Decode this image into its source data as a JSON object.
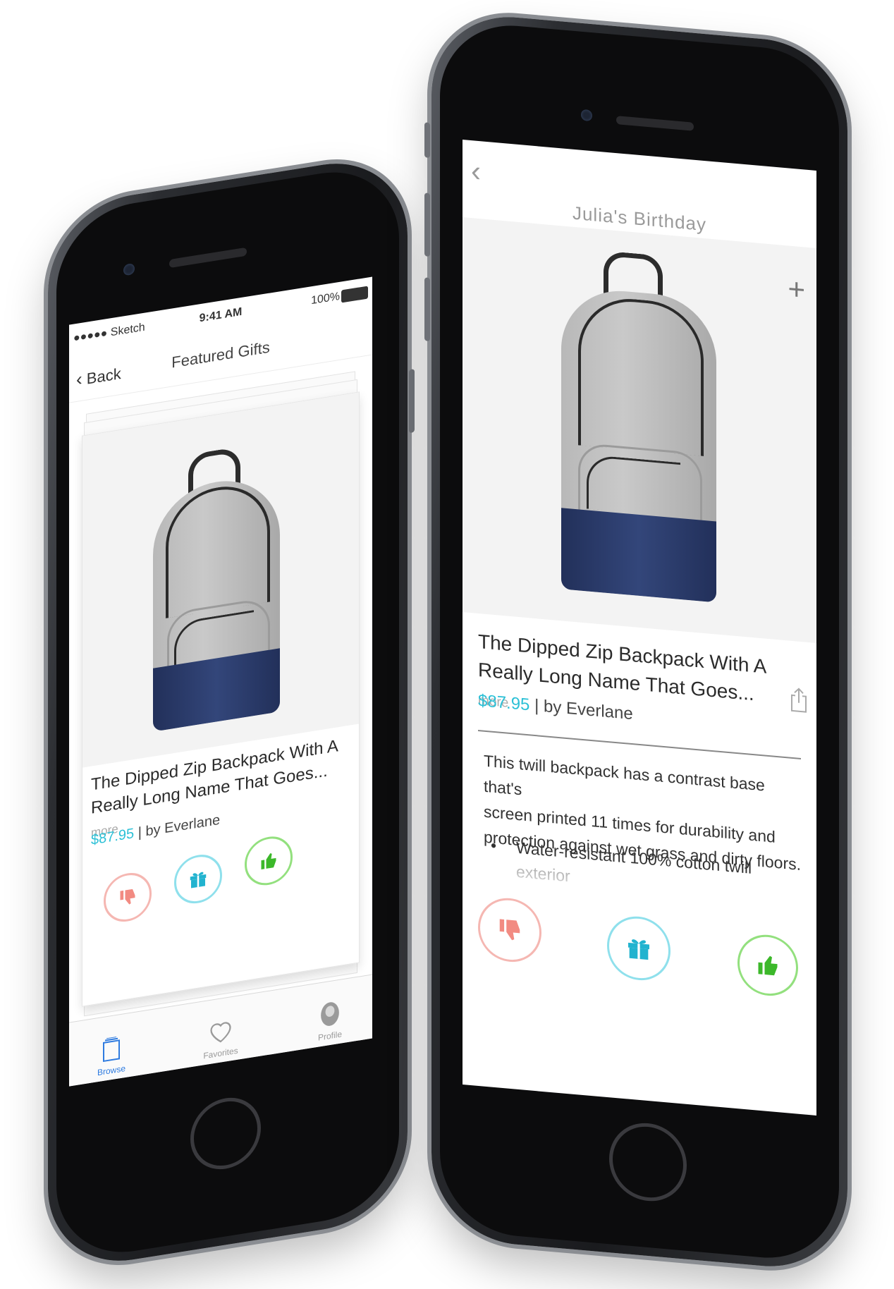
{
  "left_phone": {
    "status": {
      "carrier": "●●●●● Sketch",
      "time": "9:41 AM",
      "battery": "100%"
    },
    "nav": {
      "back_label": "Back",
      "title": "Featured Gifts"
    },
    "product": {
      "title_line1": "The Dipped Zip Backpack With A",
      "title_line2": "Really Long Name That Goes...",
      "more": "more",
      "price": "$87.95",
      "seller": "| by Everlane"
    },
    "tabs": [
      {
        "label": "Browse",
        "icon": "browse-icon"
      },
      {
        "label": "Favorites",
        "icon": "heart-icon"
      },
      {
        "label": "Profile",
        "icon": "profile-icon"
      }
    ]
  },
  "right_phone": {
    "header": {
      "title": "Julia's Birthday",
      "back_icon": "chevron-left-icon",
      "add_icon": "plus-icon"
    },
    "product": {
      "title_line1": "The Dipped Zip Backpack With A",
      "title_line2": "Really Long Name That Goes...",
      "more": "more",
      "price": "$87.95",
      "seller": "| by Everlane",
      "description_line1": "This twill backpack has a contrast base that's",
      "description_line2": "screen printed 11 times for durability and",
      "description_line3": "protection against wet grass and dirty floors.",
      "bullet_line1": "Water-resistant 100% cotton twill",
      "bullet_line2": "exterior"
    }
  },
  "colors": {
    "price": "#2bc0d6",
    "dislike": "#f28b82",
    "gift": "#22b3cf",
    "like": "#3cb82a",
    "tab_active": "#2e7be0"
  }
}
